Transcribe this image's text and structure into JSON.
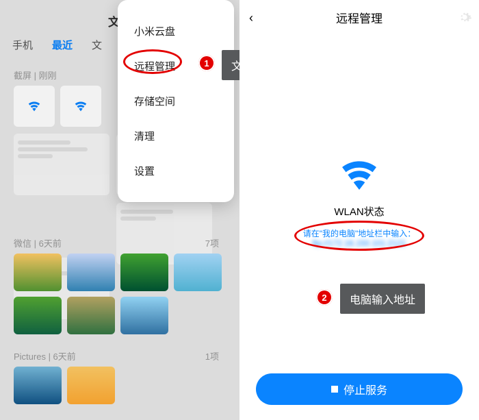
{
  "left": {
    "title": "文件",
    "tabs": [
      "手机",
      "最近",
      "文"
    ],
    "active_tab_index": 1,
    "section1_label": "截屏 | 刚刚",
    "section2_label": "微信 | 6天前",
    "section2_count": "7项",
    "section3_label": "Pictures | 6天前",
    "section3_count": "1项"
  },
  "dropdown": {
    "items": [
      "小米云盘",
      "远程管理",
      "存储空间",
      "清理",
      "设置"
    ]
  },
  "annotations": {
    "step1_num": "1",
    "step1_text": "文件管理中进入远程管理",
    "step2_num": "2",
    "step2_text": "电脑输入地址"
  },
  "right": {
    "title": "远程管理",
    "wlan_label": "WLAN状态",
    "addr_hint": "请在\"我的电脑\"地址栏中输入：",
    "addr_url": "ftp://172.16.150.101:2121",
    "stop_label": "停止服务"
  },
  "colors": {
    "accent": "#0a84ff",
    "annotation": "#e30000",
    "callout_bg": "#57595b"
  }
}
